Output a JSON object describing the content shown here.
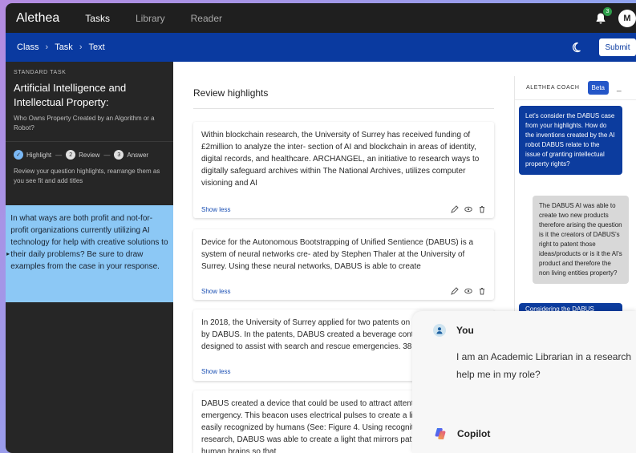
{
  "topbar": {
    "brand": "Alethea",
    "nav": [
      {
        "label": "Tasks",
        "active": true
      },
      {
        "label": "Library",
        "active": false
      },
      {
        "label": "Reader",
        "active": false
      }
    ],
    "notification_count": "3",
    "avatar_initial": "M"
  },
  "breadcrumb": [
    "Class",
    "Task",
    "Text"
  ],
  "header": {
    "submit_label": "Submit"
  },
  "sidebar": {
    "kicker": "STANDARD TASK",
    "title": "Artificial Intelligence and Intellectual Property:",
    "subtitle": "Who Owns Property Created by an Algorithm or a Robot?",
    "steps": [
      {
        "number": "",
        "label": "Highlight",
        "state": "done"
      },
      {
        "number": "2",
        "label": "Review",
        "state": "current"
      },
      {
        "number": "3",
        "label": "Answer",
        "state": "upcoming"
      }
    ],
    "steps_hint": "Review your question highlights, rearrange them as you see fit and add titles",
    "question": "In what ways are both profit and not-for-profit organizations currently utilizing AI technology for help with creative solutions to their daily problems? Be sure to draw examples from the case in your response."
  },
  "review": {
    "title": "Review highlights",
    "highlights": [
      {
        "text": "Within blockchain research, the University of Surrey has received funding of £2million to analyze the inter- section of AI and blockchain in areas of identity, digital records, and healthcare. ARCHANGEL, an initiative to research ways to digitally safeguard archives within The National Archives, utilizes computer visioning and AI",
        "toggle": "Show less"
      },
      {
        "text": "Device for the Autonomous Bootstrapping of Unified Sentience (DABUS) is a system of neural networks cre- ated by Stephen Thaler at the University of Surrey. Using these neural networks, DABUS is able to create",
        "toggle": "Show less"
      },
      {
        "text": "In 2018, the University of Surrey applied for two patents on inventions created by DABUS. In the patents, DABUS created a beverage container and a device designed to assist with search and rescue emergencies. 38",
        "toggle": "Show less"
      },
      {
        "text": "DABUS created a device that could be used to attract attention in an emergency. This beacon uses electrical pulses to create a light in a dimension easily recognized by humans (See: Figure 4. Using recognition patterns and research, DABUS was able to create a light that mirrors patterns recognized by human brains so that",
        "toggle": ""
      }
    ]
  },
  "coach": {
    "label": "ALETHEA COACH",
    "badge": "Beta",
    "minimize": "_",
    "messages": [
      {
        "role": "user",
        "text": "Let's consider the DABUS case from your highlights. How do the inventions created by the AI robot DABUS relate to the issue of granting intellectual property rights?"
      },
      {
        "role": "ai",
        "text": "The DABUS AI was able to create two new products therefore arising the question is it the creators of DABUS's right to patent those ideas/products or is it the AI's product and therefore the non living entities property?"
      },
      {
        "role": "user",
        "text": "Considering the DABUS"
      }
    ]
  },
  "copilot": {
    "you_label": "You",
    "you_message_line1": "I am an Academic Librarian in a research",
    "you_message_line2": "help me in my role?",
    "copilot_label": "Copilot"
  }
}
